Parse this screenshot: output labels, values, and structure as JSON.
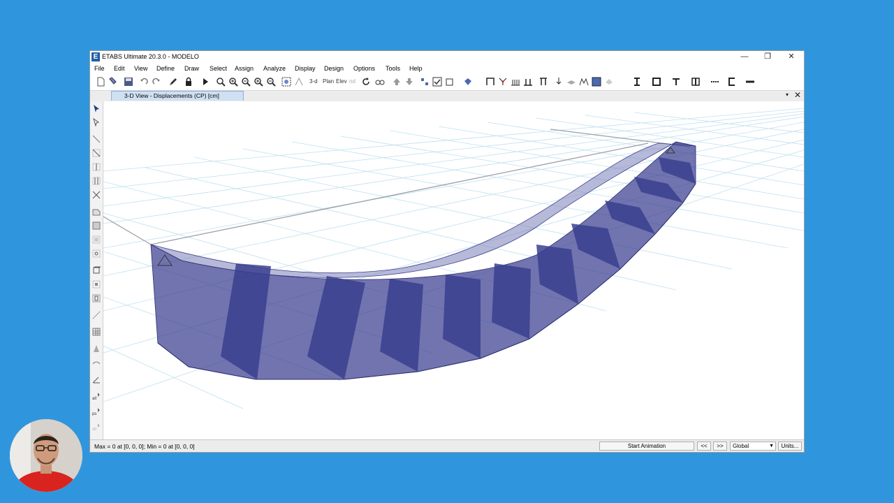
{
  "window": {
    "title": "ETABS Ultimate 20.3.0 - MODELO",
    "logo_letter": "E",
    "minimize": "—",
    "restore": "❐",
    "close": "✕"
  },
  "menu": [
    "File",
    "Edit",
    "View",
    "Define",
    "Draw",
    "Select",
    "Assign",
    "Analyze",
    "Display",
    "Design",
    "Options",
    "Tools",
    "Help"
  ],
  "toolbar": {
    "threed_label": "3-d",
    "plan_label": "Plan",
    "elev_label": "Elev",
    "nd_label": "nd"
  },
  "view_tab": {
    "label": "3-D View  - Displacements (CP)  [cm]",
    "menu_glyph": "▾",
    "close_glyph": "✕"
  },
  "status": {
    "text": "Max = 0 at [0, 0, 0];  Min = 0 at [0, 0, 0]",
    "start_animation": "Start Animation",
    "prev": "<<",
    "next": ">>",
    "coord_system": "Global",
    "units": "Units..."
  },
  "colors": {
    "background": "#2f96dd",
    "deformed_fill": "#3a3f8f",
    "grid": "#bfe0f0",
    "tab_active": "#cfe0f3"
  },
  "icons": {
    "new": "new-file-icon",
    "open": "open-icon",
    "save": "save-icon",
    "undo": "undo-icon",
    "redo": "redo-icon",
    "lock": "lock-icon",
    "run": "run-icon",
    "zoom": "zoom-icon"
  }
}
